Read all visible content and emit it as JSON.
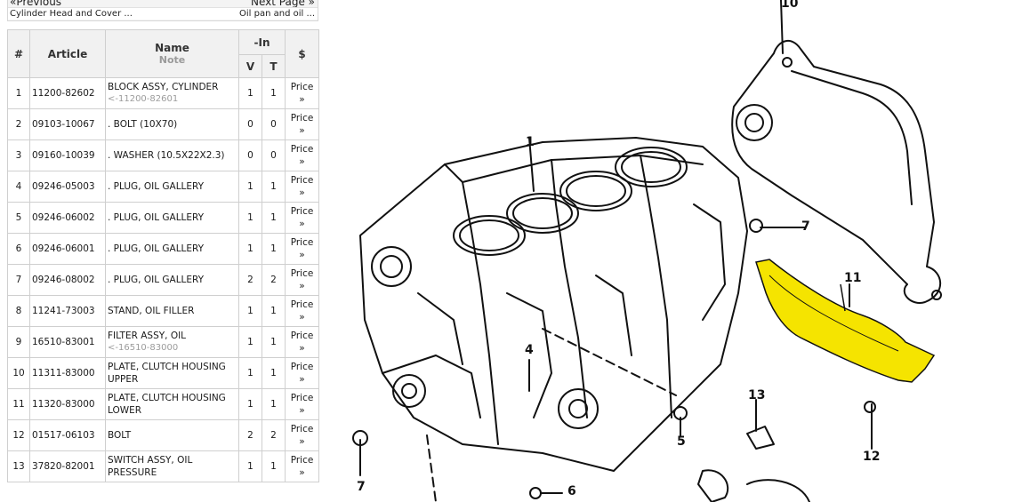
{
  "nav": {
    "prev_label": "«Previous",
    "next_label": "Next Page »",
    "prev_section": "Cylinder Head and Cover ...",
    "next_section": "Oil pan and oil ..."
  },
  "table": {
    "headers": {
      "num": "#",
      "article": "Article",
      "name": "Name",
      "note": "Note",
      "in": "-In",
      "v": "V",
      "t": "T",
      "price": "$"
    },
    "rows": [
      {
        "num": "1",
        "article": "11200-82602",
        "name": "BLOCK ASSY, CYLINDER",
        "note": "<-11200-82601",
        "v": "1",
        "t": "1",
        "price": "Price »"
      },
      {
        "num": "2",
        "article": "09103-10067",
        "name": ". BOLT (10X70)",
        "note": "",
        "v": "0",
        "t": "0",
        "price": "Price »"
      },
      {
        "num": "3",
        "article": "09160-10039",
        "name": ". WASHER (10.5X22X2.3)",
        "note": "",
        "v": "0",
        "t": "0",
        "price": "Price »"
      },
      {
        "num": "4",
        "article": "09246-05003",
        "name": ". PLUG, OIL GALLERY",
        "note": "",
        "v": "1",
        "t": "1",
        "price": "Price »"
      },
      {
        "num": "5",
        "article": "09246-06002",
        "name": ". PLUG, OIL GALLERY",
        "note": "",
        "v": "1",
        "t": "1",
        "price": "Price »"
      },
      {
        "num": "6",
        "article": "09246-06001",
        "name": ". PLUG, OIL GALLERY",
        "note": "",
        "v": "1",
        "t": "1",
        "price": "Price »"
      },
      {
        "num": "7",
        "article": "09246-08002",
        "name": ". PLUG, OIL GALLERY",
        "note": "",
        "v": "2",
        "t": "2",
        "price": "Price »"
      },
      {
        "num": "8",
        "article": "11241-73003",
        "name": "STAND, OIL FILLER",
        "note": "",
        "v": "1",
        "t": "1",
        "price": "Price »"
      },
      {
        "num": "9",
        "article": "16510-83001",
        "name": "FILTER ASSY, OIL",
        "note": "<-16510-83000",
        "v": "1",
        "t": "1",
        "price": "Price »"
      },
      {
        "num": "10",
        "article": "11311-83000",
        "name": "PLATE, CLUTCH HOUSING UPPER",
        "note": "",
        "v": "1",
        "t": "1",
        "price": "Price »"
      },
      {
        "num": "11",
        "article": "11320-83000",
        "name": "PLATE, CLUTCH HOUSING LOWER",
        "note": "",
        "v": "1",
        "t": "1",
        "price": "Price »"
      },
      {
        "num": "12",
        "article": "01517-06103",
        "name": "BOLT",
        "note": "",
        "v": "2",
        "t": "2",
        "price": "Price »"
      },
      {
        "num": "13",
        "article": "37820-82001",
        "name": "SWITCH ASSY, OIL PRESSURE",
        "note": "",
        "v": "1",
        "t": "1",
        "price": "Price »"
      }
    ]
  },
  "diagram": {
    "callouts": [
      "10",
      "1",
      "7",
      "11",
      "4",
      "13",
      "5",
      "12",
      "7",
      "6"
    ],
    "highlight_color": "#f5e400",
    "line_color": "#111111"
  }
}
